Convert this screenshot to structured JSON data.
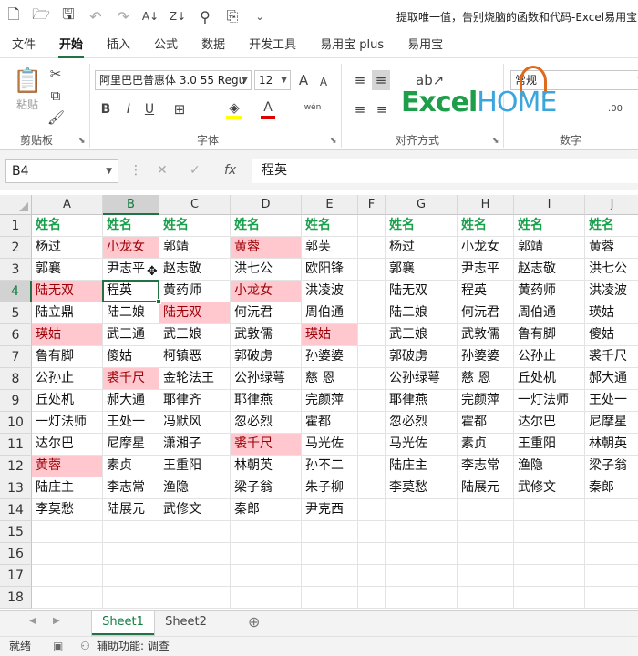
{
  "window": {
    "title": "提取唯一值，告别烧脑的函数和代码-Excel易用宝..."
  },
  "quick_access": {
    "icons": [
      "new-file-icon",
      "open-folder-icon",
      "save-icon",
      "undo-icon",
      "redo-icon",
      "sort-az-icon",
      "sort-za-icon",
      "search-icon",
      "find-replace-icon",
      "customize-icon"
    ]
  },
  "tabs": [
    "文件",
    "开始",
    "插入",
    "公式",
    "数据",
    "开发工具",
    "易用宝 plus",
    "易用宝"
  ],
  "ribbon": {
    "clipboard": {
      "paste": "粘贴",
      "label": "剪贴板"
    },
    "font": {
      "family": "阿里巴巴普惠体 3.0 55 Regu",
      "size": "12",
      "bold": "B",
      "italic": "I",
      "underline": "U",
      "grow": "A",
      "shrink": "A",
      "phonetic": "wén",
      "label": "字体"
    },
    "alignment": {
      "label": "对齐方式"
    },
    "number": {
      "format": "常规",
      "label": "数字"
    },
    "logo_a": "Excel",
    "logo_b": "HOME"
  },
  "formula_bar": {
    "name_box": "B4",
    "fx": "fx",
    "value": "程英"
  },
  "sheet": {
    "columns": [
      "A",
      "B",
      "C",
      "D",
      "E",
      "F",
      "G",
      "H",
      "I",
      "J"
    ],
    "rows": [
      "1",
      "2",
      "3",
      "4",
      "5",
      "6",
      "7",
      "8",
      "9",
      "10",
      "11",
      "12",
      "13",
      "14",
      "15",
      "16",
      "17",
      "18"
    ],
    "selected_cell": "B4",
    "cells": {
      "A": [
        "姓名",
        "杨过",
        "郭襄",
        "陆无双",
        "陆立鼎",
        "瑛姑",
        "鲁有脚",
        "公孙止",
        "丘处机",
        "一灯法师",
        "达尔巴",
        "黄蓉",
        "陆庄主",
        "李莫愁"
      ],
      "B": [
        "姓名",
        "小龙女",
        "尹志平",
        "程英",
        "陆二娘",
        "武三通",
        "傻姑",
        "裘千尺",
        "郝大通",
        "王处一",
        "尼摩星",
        "素贞",
        "李志常",
        "陆展元"
      ],
      "C": [
        "姓名",
        "郭靖",
        "赵志敬",
        "黄药师",
        "陆无双",
        "武三娘",
        "柯镇恶",
        "金轮法王",
        "耶律齐",
        "冯默风",
        "潇湘子",
        "王重阳",
        "渔隐",
        "武修文"
      ],
      "D": [
        "姓名",
        "黄蓉",
        "洪七公",
        "小龙女",
        "何沅君",
        "武敦儒",
        "郭破虏",
        "公孙绿萼",
        "耶律燕",
        "忽必烈",
        "裘千尺",
        "林朝英",
        "梁子翁",
        "秦郎"
      ],
      "E": [
        "姓名",
        "郭芙",
        "欧阳锋",
        "洪凌波",
        "周伯通",
        "瑛姑",
        "孙婆婆",
        "慈 恩",
        "完颜萍",
        "霍都",
        "马光佐",
        "孙不二",
        "朱子柳",
        "尹克西"
      ],
      "F": [],
      "G": [
        "姓名",
        "杨过",
        "郭襄",
        "陆无双",
        "陆二娘",
        "武三娘",
        "郭破虏",
        "公孙绿萼",
        "耶律燕",
        "忽必烈",
        "马光佐",
        "陆庄主",
        "李莫愁"
      ],
      "H": [
        "姓名",
        "小龙女",
        "尹志平",
        "程英",
        "何沅君",
        "武敦儒",
        "孙婆婆",
        "慈 恩",
        "完颜萍",
        "霍都",
        "素贞",
        "李志常",
        "陆展元"
      ],
      "I": [
        "姓名",
        "郭靖",
        "赵志敬",
        "黄药师",
        "周伯通",
        "鲁有脚",
        "公孙止",
        "丘处机",
        "一灯法师",
        "达尔巴",
        "王重阳",
        "渔隐",
        "武修文"
      ],
      "J": [
        "姓名",
        "黄蓉",
        "洪七公",
        "洪凌波",
        "瑛姑",
        "傻姑",
        "裘千尺",
        "郝大通",
        "王处一",
        "尼摩星",
        "林朝英",
        "梁子翁",
        "秦郎"
      ]
    },
    "highlighted": [
      "B2",
      "D2",
      "A4",
      "D4",
      "C5",
      "A6",
      "E6",
      "B8",
      "D11",
      "A12"
    ],
    "highlight_color": "#ffc7ce",
    "header_color": "#18a04a"
  },
  "sheet_tabs": [
    "Sheet1",
    "Sheet2"
  ],
  "status": {
    "ready": "就绪",
    "accessibility": "辅助功能: 调查"
  }
}
